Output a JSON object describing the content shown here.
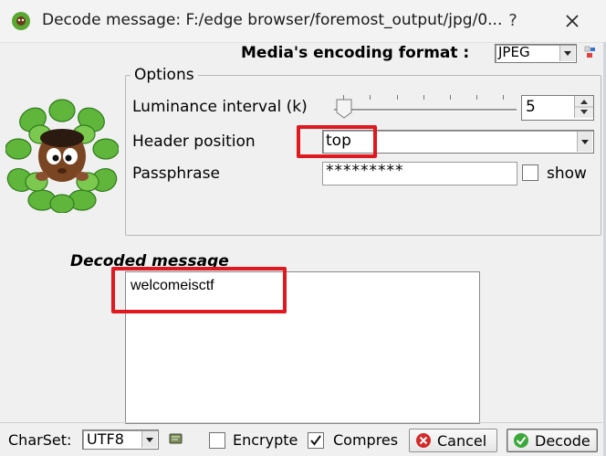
{
  "window": {
    "title": "Decode message: F:/edge browser/foremost_output/jpg/0...",
    "help": "?",
    "close": "✕"
  },
  "media": {
    "label": "Media's encoding format :",
    "value": "JPEG"
  },
  "options": {
    "legend": "Options",
    "luminance_label": "Luminance interval (k)",
    "luminance_value": "5",
    "luminance_level_fraction": 0.02,
    "header_label": "Header position",
    "header_value": "top",
    "passphrase_label": "Passphrase",
    "passphrase_value": "*********",
    "show_label": "show",
    "show_checked": false
  },
  "decoded": {
    "label": "Decoded message",
    "text": "welcomeisctf"
  },
  "bottom": {
    "charset_label": "CharSet:",
    "charset_value": "UTF8",
    "encrypted_label": "Encrypted",
    "encrypted_checked": false,
    "compressed_label": "Compres",
    "compressed_checked": true,
    "cancel_label": "Cancel",
    "decode_label": "Decode"
  },
  "colors": {
    "highlight": "#e01820",
    "background": "#f0f0f0"
  },
  "icons": [
    "app-mascot-icon",
    "help-icon",
    "close-icon",
    "dropdown-arrow-icon",
    "palette-icon",
    "spin-up-icon",
    "spin-down-icon",
    "tool-icon",
    "cancel-icon",
    "decode-check-icon",
    "mascot-leaves-icon"
  ]
}
